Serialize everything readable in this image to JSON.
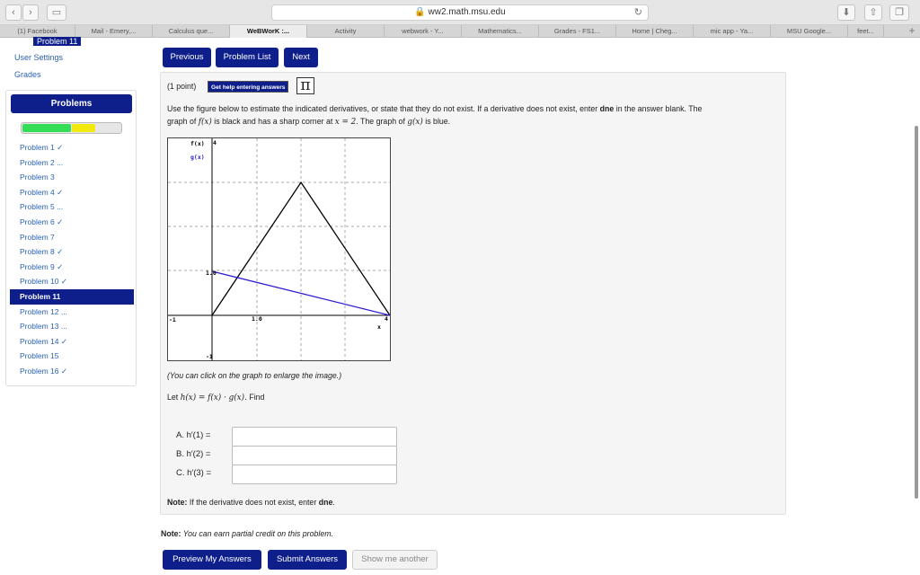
{
  "browser": {
    "url": "ww2.math.msu.edu",
    "tabs": [
      {
        "label": "(1) Facebook",
        "w": 84
      },
      {
        "label": "Mail - Emery,...",
        "w": 86
      },
      {
        "label": "Calculus que...",
        "w": 86
      },
      {
        "label": "WeBWorK :...",
        "w": 86
      },
      {
        "label": "Activity",
        "w": 86
      },
      {
        "label": "webwork - Y...",
        "w": 86
      },
      {
        "label": "Mathematics...",
        "w": 86
      },
      {
        "label": "Grades - FS1...",
        "w": 86
      },
      {
        "label": "Home | Cheg...",
        "w": 86
      },
      {
        "label": "mic app - Ya...",
        "w": 86
      },
      {
        "label": "MSU Google...",
        "w": 86
      },
      {
        "label": "feet...",
        "w": 40
      }
    ],
    "active_tab_index": 3
  },
  "sidebar": {
    "current_problem": "Problem 11",
    "user_settings": "User Settings",
    "grades": "Grades",
    "problems_header": "Problems",
    "progress": {
      "green_fraction": 0.5,
      "yellow_fraction": 0.25
    },
    "problems": [
      {
        "label": "Problem 1 ✓"
      },
      {
        "label": "Problem 2 ..."
      },
      {
        "label": "Problem 3"
      },
      {
        "label": "Problem 4 ✓"
      },
      {
        "label": "Problem 5 ..."
      },
      {
        "label": "Problem 6 ✓"
      },
      {
        "label": "Problem 7"
      },
      {
        "label": "Problem 8 ✓"
      },
      {
        "label": "Problem 9 ✓"
      },
      {
        "label": "Problem 10 ✓"
      },
      {
        "label": "Problem 11"
      },
      {
        "label": "Problem 12 ..."
      },
      {
        "label": "Problem 13 ..."
      },
      {
        "label": "Problem 14 ✓"
      },
      {
        "label": "Problem 15"
      },
      {
        "label": "Problem 16 ✓"
      }
    ],
    "active_index": 10
  },
  "nav": {
    "previous": "Previous",
    "problem_list": "Problem List",
    "next": "Next"
  },
  "problem": {
    "points": "(1 point)",
    "help_button": "Get help entering answers",
    "pi_symbol": "π",
    "instructions_line1_a": "Use the figure below to estimate the indicated derivatives, or state that they do not exist. If a derivative does not exist, enter ",
    "instructions_bold_dne": "dne",
    "instructions_line1_b": " in the answer blank. The",
    "instructions_line2_a": "graph of ",
    "instructions_fx": "f(x)",
    "instructions_line2_b": " is black and has a sharp corner at ",
    "instructions_x2": "x = 2",
    "instructions_line2_c": ". The graph of ",
    "instructions_gx": "g(x)",
    "instructions_line2_d": " is blue.",
    "graph": {
      "label_f": "f(x)",
      "label_g": "g(x)",
      "label_x": "x",
      "tick_y_top": "4",
      "tick_y1": "1.0",
      "tick_x1": "1.0",
      "tick_x_right": "4",
      "tick_x_left": "-1",
      "tick_y_bottom": "-1",
      "colors": {
        "f": "#000000",
        "g": "#2b1cd6",
        "grid": "#aaaaaa"
      }
    },
    "enlarge_note": "(You can click on the graph to enlarge the image.)",
    "let_text_a": "Let ",
    "let_expr": "h(x) = f(x) · g(x).",
    "let_text_b": " Find",
    "answers": [
      {
        "label": "A. h′(1) =",
        "value": ""
      },
      {
        "label": "B. h′(2) =",
        "value": ""
      },
      {
        "label": "C. h′(3) =",
        "value": ""
      }
    ],
    "note_bold": "Note:",
    "note_text_a": " If the derivative does not exist, enter ",
    "note_text_b": "dne",
    "note_text_c": "."
  },
  "footer": {
    "partial_bold": "Note:",
    "partial_text": " You can earn partial credit on this problem.",
    "preview": "Preview My Answers",
    "submit": "Submit Answers",
    "another": "Show me another"
  }
}
